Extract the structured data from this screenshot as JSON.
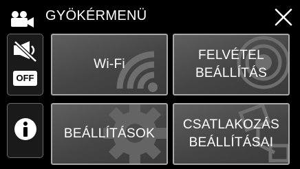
{
  "header": {
    "title": "GYÖKÉRMENÜ",
    "icon": "movie-camera-icon"
  },
  "close_button": {
    "icon": "close-icon"
  },
  "sidebar": {
    "mute": {
      "icon": "mute-icon",
      "badge": "OFF"
    },
    "info": {
      "icon": "info-icon"
    }
  },
  "tiles": [
    {
      "line1": "Wi-Fi",
      "line2": "",
      "icon": "wifi-icon"
    },
    {
      "line1": "FELVÉTEL",
      "line2": "BEÁLLÍTÁS",
      "icon": "record-icon"
    },
    {
      "line1": "BEÁLLÍTÁSOK",
      "line2": "",
      "icon": "gear-icon"
    },
    {
      "line1": "CSATLAKOZÁS",
      "line2": "BEÁLLÍTÁSAI",
      "icon": "connection-icon"
    }
  ],
  "colors": {
    "background": "#000000",
    "tile": "#4a4a4a",
    "tile_border": "#a9a9a9",
    "text": "#ffffff"
  }
}
